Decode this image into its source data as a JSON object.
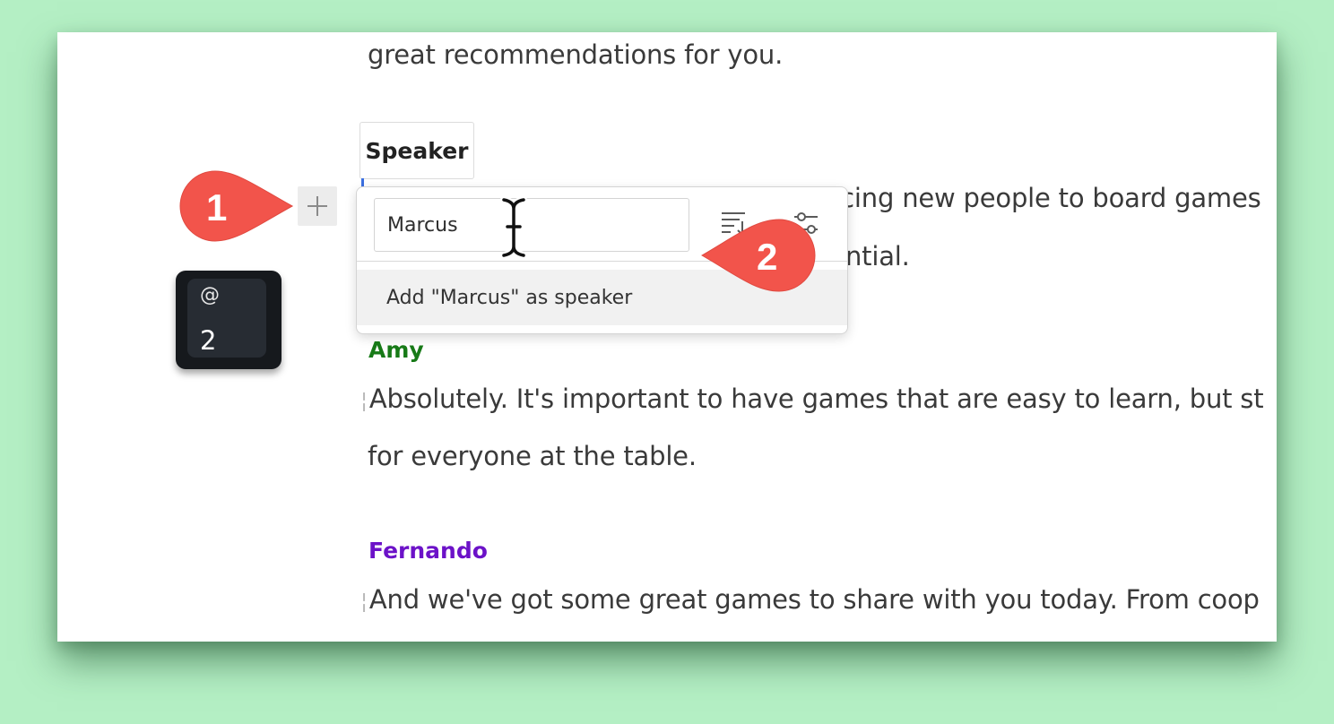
{
  "document": {
    "line_top": "great recommendations for you.",
    "marcus_line_1": "ucing new people to board games",
    "marcus_line_2": "ntial.",
    "amy": {
      "name": "Amy",
      "line_1": "Absolutely. It's important to have games that are easy to learn, but st",
      "line_2": "for everyone at the table."
    },
    "fernando": {
      "name": "Fernando",
      "line_1": "And we've got some great games to share with you today. From coop"
    },
    "colors": {
      "amy": "#177a17",
      "fernando": "#6c12c8"
    }
  },
  "speaker_tab": {
    "label": "Speaker"
  },
  "dropdown": {
    "search_value": "Marcus",
    "option_label": "Add \"Marcus\" as speaker",
    "icons": [
      "sort-icon",
      "filter-sliders-icon"
    ]
  },
  "add_button": {
    "icon": "plus-icon"
  },
  "shortcut_key": {
    "symbol": "@",
    "number": "2"
  },
  "callouts": {
    "first": {
      "number": "1",
      "color": "#f2544b"
    },
    "second": {
      "number": "2",
      "color": "#f2544b"
    }
  }
}
